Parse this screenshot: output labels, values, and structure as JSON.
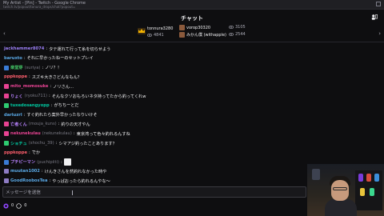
{
  "window": {
    "title": "My Artist - [Pin] - Twitch - Google Chrome",
    "url": "twitch.tv/popout/tonura_drops/chat?popout="
  },
  "header": {
    "title": "チャット"
  },
  "pinned": {
    "gift1": {
      "name": "tonnura3280",
      "views": "4841"
    },
    "gift2a": {
      "name": "vorop30320",
      "views": "3105"
    },
    "gift2b": {
      "name": "みかん僕 (withapple)",
      "views": "2544"
    }
  },
  "messages": [
    {
      "user": "jackhammer8074",
      "user_color": "#9b7ff5",
      "text": "タテ運れて行って糸を切らせよう",
      "badge": "",
      "badge_color": ""
    },
    {
      "user": "baruxto",
      "user_color": "#5aa9e6",
      "text": "それに早かったねーのセットプレイ",
      "badge": "",
      "badge_color": ""
    },
    {
      "user": "楽堂芽",
      "alt": "(suriya)",
      "user_color": "#44c767",
      "text": "ノリ？！",
      "badge": "★",
      "badge_color": "#3a7bd5"
    },
    {
      "user": "pppkoppe",
      "user_color": "#ff5f6d",
      "text": "スズキ大きさどんなもん？",
      "badge": "",
      "badge_color": ""
    },
    {
      "user": "mito_momosuke",
      "user_color": "#e84393",
      "text": "ノリさん…",
      "badge": "◆",
      "badge_color": "#e84393"
    },
    {
      "user": "りょく",
      "alt": "(ryoku711)",
      "user_color": "#b983ff",
      "text": "そんなクソおもろいネタ持ってたから釣ってくれw",
      "badge": "◆",
      "badge_color": "#e84393"
    },
    {
      "user": "tuxedosangyopp",
      "user_color": "#00c8a0",
      "text": "がちちーとだ",
      "badge": "●",
      "badge_color": "#2ecc71"
    },
    {
      "user": "dariuzrl",
      "user_color": "#5aa9e6",
      "text": "すぐ釣れたら案外早かったなりいけそ",
      "badge": "",
      "badge_color": ""
    },
    {
      "user": "亡者くん",
      "alt": "(mouja_kuns)",
      "user_color": "#b983ff",
      "text": "釣りの天才やん",
      "badge": "◆",
      "badge_color": "#e84393"
    },
    {
      "user": "nekunekulau",
      "alt": "(nekunekulau)",
      "user_color": "#e84393",
      "text": "東京湾って色々釣れるんすね",
      "badge": "◆",
      "badge_color": "#e84393"
    },
    {
      "user": "ショチュ",
      "alt": "(shochu_39)",
      "user_color": "#00c8a0",
      "text": "シマアジ釣ったことあります？",
      "badge": "●",
      "badge_color": "#2ecc71"
    },
    {
      "user": "pppkoppe",
      "user_color": "#ff5f6d",
      "text": "でか",
      "badge": "",
      "badge_color": ""
    },
    {
      "user": "プチピーマン",
      "alt": "(puchipiiti)",
      "user_color": "#b983ff",
      "text": "",
      "badge": "★",
      "badge_color": "#3a7bd5",
      "emote": true
    },
    {
      "user": "muutan1002",
      "user_color": "#5aa9e6",
      "text": "けんきさんを然釣れなかった時や",
      "badge": "◆",
      "badge_color": "#8e7cc3"
    },
    {
      "user": "GoodRoobosTea",
      "user_color": "#5aa9e6",
      "text": "やっぱおったら釣れるんやな〜",
      "badge": "◆",
      "badge_color": "#8e7cc3"
    }
  ],
  "input": {
    "placeholder": "メッセージを送信"
  },
  "bottom": {
    "points": "0",
    "items": "0"
  },
  "colors": {
    "background": "#0e0e10",
    "accent": "#9147ff"
  }
}
